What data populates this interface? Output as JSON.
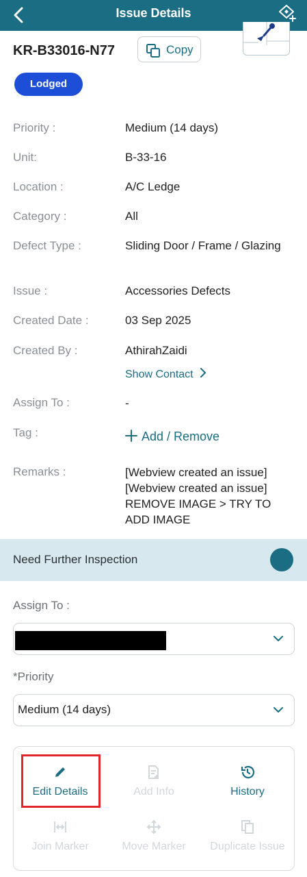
{
  "header": {
    "title": "Issue Details",
    "bg_color": "#1a6d82"
  },
  "issue": {
    "id": "KR-B33016-N77",
    "copy_label": "Copy",
    "status": "Lodged",
    "status_color": "#1d4ed8"
  },
  "details": {
    "priority_label": "Priority :",
    "priority_value": "Medium (14 days)",
    "unit_label": "Unit:",
    "unit_value": "B-33-16",
    "location_label": "Location :",
    "location_value": "A/C Ledge",
    "category_label": "Category :",
    "category_value": "All",
    "defect_label": "Defect Type :",
    "defect_value": "Sliding Door / Frame / Glazing",
    "issue_label": "Issue :",
    "issue_value": "Accessories Defects",
    "created_date_label": "Created Date :",
    "created_date_value": "03 Sep 2025",
    "created_by_label": "Created By :",
    "created_by_value": "AthirahZaidi",
    "show_contact": "Show Contact",
    "assign_label": "Assign To :",
    "assign_value": "-",
    "tag_label": "Tag :",
    "tag_action": "Add / Remove",
    "remarks_label": "Remarks :",
    "remarks_value": "[Webview created an issue] [Webview created an issue] REMOVE IMAGE > TRY TO ADD IMAGE"
  },
  "inspection": {
    "label": "Need Further Inspection",
    "toggle_on": true
  },
  "form": {
    "assign_label": "Assign To :",
    "assign_value_redacted": true,
    "priority_label": "*Priority",
    "priority_value": "Medium (14 days)"
  },
  "actions": {
    "edit": "Edit Details",
    "add_info": "Add Info",
    "history": "History",
    "join_marker": "Join Marker",
    "move_marker": "Move Marker",
    "duplicate": "Duplicate Issue",
    "highlight_color": "#e0262b"
  }
}
